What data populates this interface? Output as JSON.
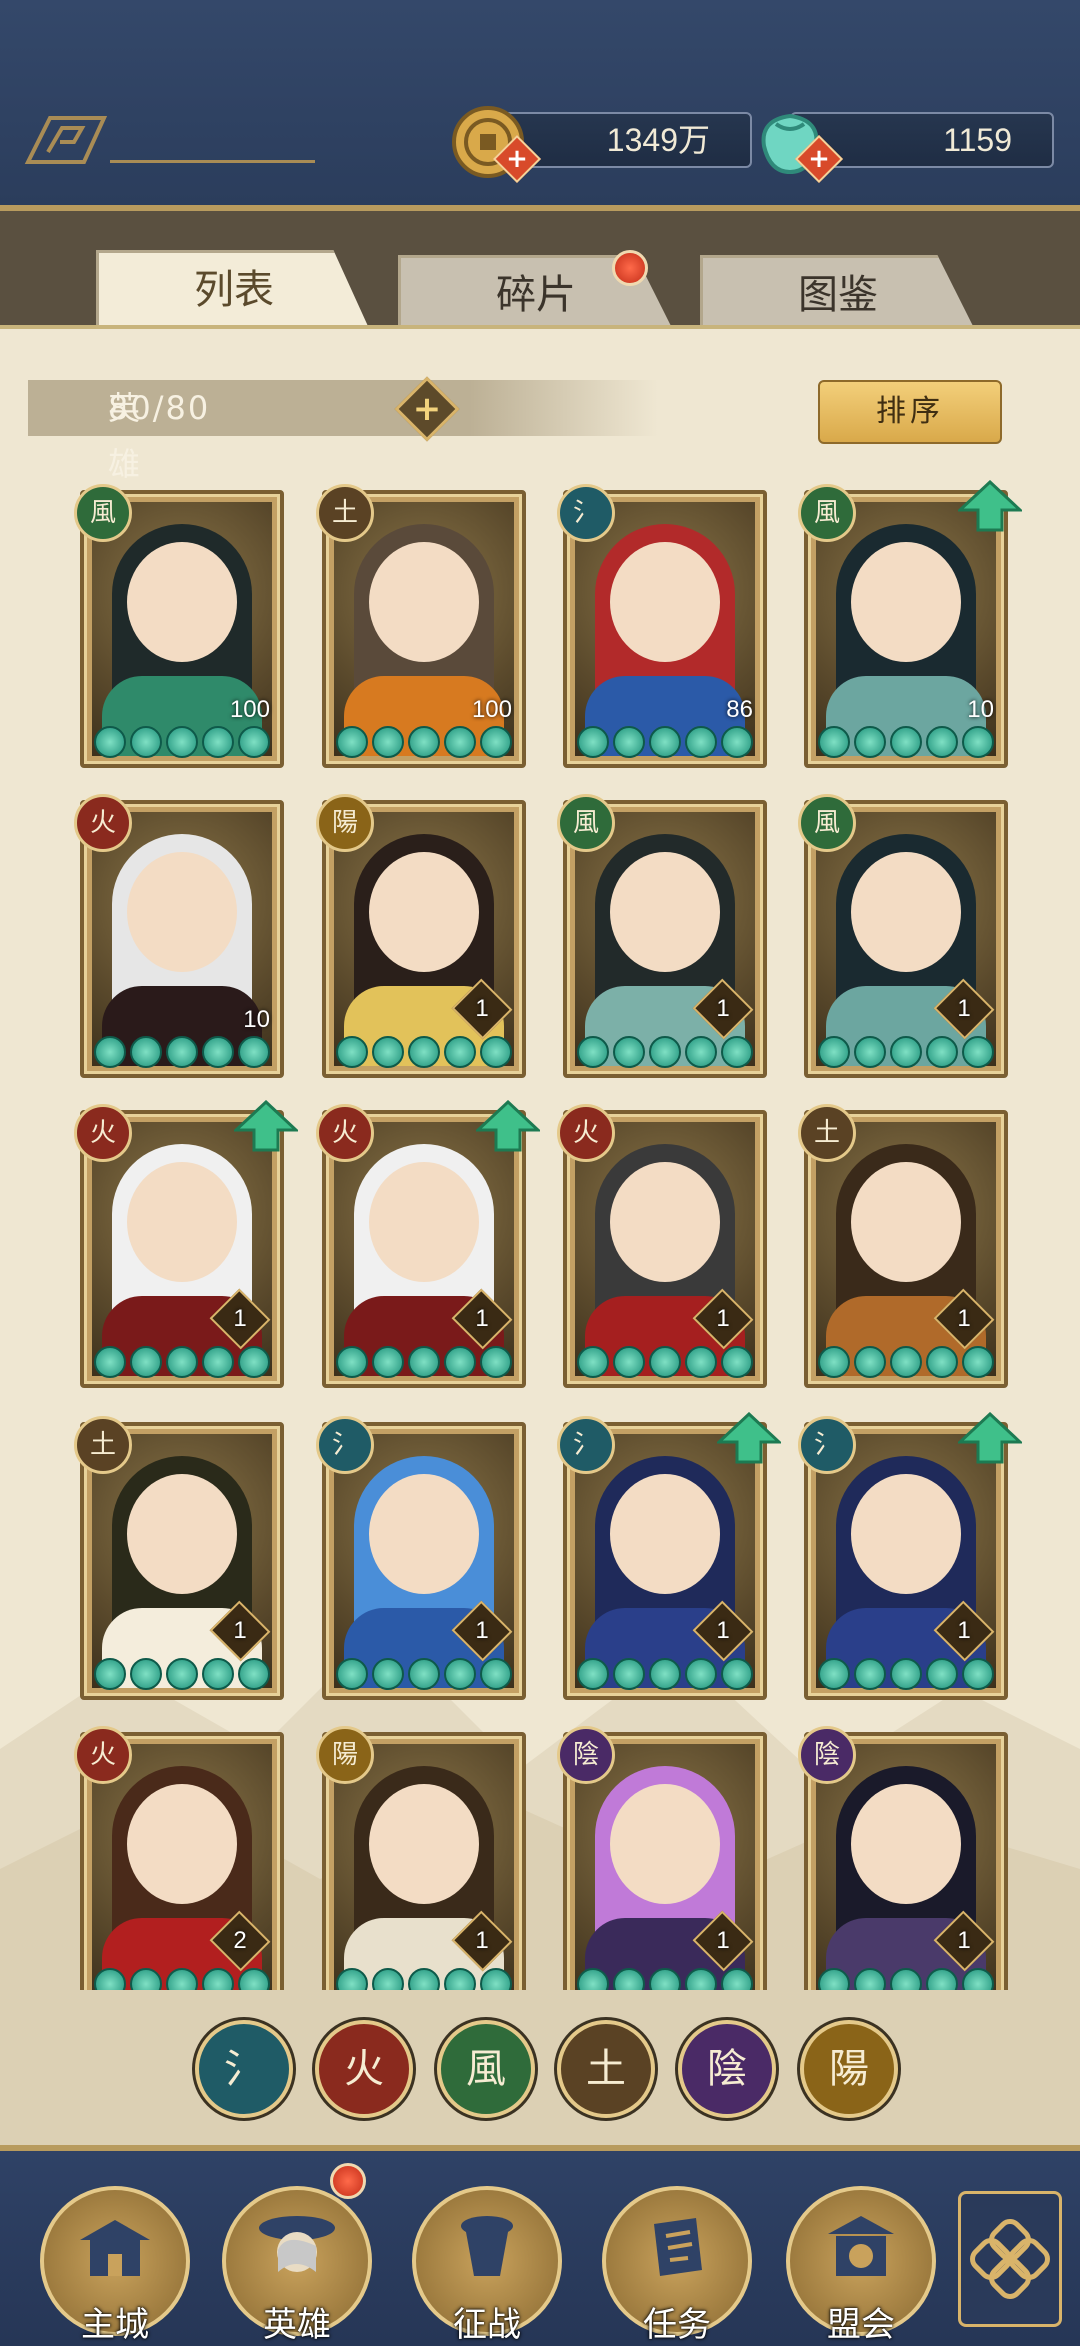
{
  "resources": {
    "coins": "1349万",
    "jade": "1159"
  },
  "tabs": [
    "列表",
    "碎片",
    "图鉴"
  ],
  "hero_count": {
    "label": "英雄数量:",
    "value": "80/80"
  },
  "sort_label": "排序",
  "element_glyphs": {
    "water": "氵",
    "fire": "火",
    "wind": "風",
    "earth": "土",
    "yin": "陰",
    "yang": "陽"
  },
  "colors": {
    "water": "#1f5b66",
    "fire": "#8a2a1e",
    "wind": "#2f6b3a",
    "earth": "#5a4224",
    "yin": "#4a2a66",
    "yang": "#8a6418"
  },
  "heroes": [
    {
      "element": "wind",
      "level": "100",
      "upgrade": false,
      "hair": "#1f2a2a",
      "robe": "#2f8a6a"
    },
    {
      "element": "earth",
      "level": "100",
      "upgrade": false,
      "hair": "#5a4a3a",
      "robe": "#d77a20"
    },
    {
      "element": "water",
      "level": "86",
      "upgrade": false,
      "hair": "#b22a2a",
      "robe": "#2b5aa8"
    },
    {
      "element": "wind",
      "level": "10",
      "upgrade": true,
      "hair": "#1a2a30",
      "robe": "#6ca6a0"
    },
    {
      "element": "fire",
      "level": "10",
      "upgrade": false,
      "hair": "#e6e6e6",
      "robe": "#2a1a1a"
    },
    {
      "element": "yang",
      "level": "1",
      "upgrade": false,
      "hair": "#2a1f1a",
      "robe": "#e2c25a"
    },
    {
      "element": "wind",
      "level": "1",
      "upgrade": false,
      "hair": "#222a2a",
      "robe": "#7cb0a8"
    },
    {
      "element": "wind",
      "level": "1",
      "upgrade": false,
      "hair": "#1a2a30",
      "robe": "#6ca6a0"
    },
    {
      "element": "fire",
      "level": "1",
      "upgrade": true,
      "hair": "#f0f0f0",
      "robe": "#7a1a1a"
    },
    {
      "element": "fire",
      "level": "1",
      "upgrade": true,
      "hair": "#f0f0f0",
      "robe": "#7a1a1a"
    },
    {
      "element": "fire",
      "level": "1",
      "upgrade": false,
      "hair": "#3a3a3a",
      "robe": "#a51f1f"
    },
    {
      "element": "earth",
      "level": "1",
      "upgrade": false,
      "hair": "#3a2a1a",
      "robe": "#b06a2a"
    },
    {
      "element": "earth",
      "level": "1",
      "upgrade": false,
      "hair": "#2a2a1a",
      "robe": "#f4eddc"
    },
    {
      "element": "water",
      "level": "1",
      "upgrade": false,
      "hair": "#4a8ed8",
      "robe": "#2b5aa8"
    },
    {
      "element": "water",
      "level": "1",
      "upgrade": true,
      "hair": "#1f2a5a",
      "robe": "#2a3f8a"
    },
    {
      "element": "water",
      "level": "1",
      "upgrade": true,
      "hair": "#1f2a5a",
      "robe": "#2a3f8a"
    },
    {
      "element": "fire",
      "level": "2",
      "upgrade": false,
      "hair": "#4a2a1a",
      "robe": "#b21f1f"
    },
    {
      "element": "yang",
      "level": "1",
      "upgrade": false,
      "hair": "#3a2a1a",
      "robe": "#e8e0cc"
    },
    {
      "element": "yin",
      "level": "1",
      "upgrade": false,
      "hair": "#c07ad8",
      "robe": "#3a2a5a"
    },
    {
      "element": "yin",
      "level": "1",
      "upgrade": false,
      "hair": "#1a1a2a",
      "robe": "#4a3a6a"
    }
  ],
  "element_filters": [
    "water",
    "fire",
    "wind",
    "earth",
    "yin",
    "yang"
  ],
  "nav": [
    {
      "label": "主城",
      "icon": "main-city-icon"
    },
    {
      "label": "英雄",
      "icon": "hero-icon"
    },
    {
      "label": "征战",
      "icon": "campaign-icon"
    },
    {
      "label": "任务",
      "icon": "quest-icon"
    },
    {
      "label": "盟会",
      "icon": "guild-icon"
    }
  ]
}
